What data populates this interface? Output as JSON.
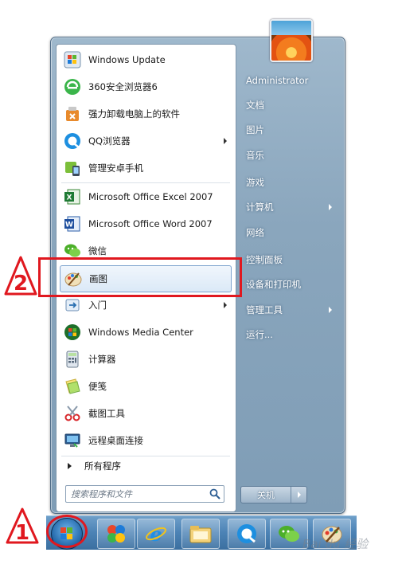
{
  "start_menu": {
    "programs": [
      {
        "label": "Windows Update",
        "icon": "windows-update-icon"
      },
      {
        "label": "360安全浏览器6",
        "icon": "360-browser-icon"
      },
      {
        "label": "强力卸载电脑上的软件",
        "icon": "uninstall-icon"
      },
      {
        "label": "QQ浏览器",
        "icon": "qq-browser-icon",
        "has_submenu": true
      },
      {
        "label": "管理安卓手机",
        "icon": "android-manager-icon"
      },
      {
        "label": "Microsoft Office Excel 2007",
        "icon": "excel-icon"
      },
      {
        "label": "Microsoft Office Word 2007",
        "icon": "word-icon"
      },
      {
        "label": "微信",
        "icon": "wechat-icon"
      },
      {
        "label": "画图",
        "icon": "paint-icon",
        "highlighted": true
      },
      {
        "label": "入门",
        "icon": "getting-started-icon",
        "has_submenu": true
      },
      {
        "label": "Windows Media Center",
        "icon": "media-center-icon"
      },
      {
        "label": "计算器",
        "icon": "calculator-icon"
      },
      {
        "label": "便笺",
        "icon": "sticky-notes-icon"
      },
      {
        "label": "截图工具",
        "icon": "snipping-tool-icon"
      },
      {
        "label": "远程桌面连接",
        "icon": "remote-desktop-icon"
      }
    ],
    "all_programs": "所有程序",
    "search_placeholder": "搜索程序和文件",
    "right_items": [
      {
        "label": "Administrator"
      },
      {
        "label": "文档"
      },
      {
        "label": "图片"
      },
      {
        "label": "音乐"
      },
      {
        "label": "游戏"
      },
      {
        "label": "计算机",
        "has_submenu": true
      },
      {
        "label": "网络"
      },
      {
        "label": "控制面板"
      },
      {
        "label": "设备和打印机"
      },
      {
        "label": "管理工具",
        "has_submenu": true
      },
      {
        "label": "运行..."
      }
    ],
    "shutdown_label": "关机"
  },
  "taskbar": {
    "items": [
      {
        "icon": "start-orb-icon"
      },
      {
        "icon": "360-browser-icon"
      },
      {
        "icon": "internet-explorer-icon"
      },
      {
        "icon": "file-explorer-icon"
      },
      {
        "icon": "qq-browser-icon"
      },
      {
        "icon": "wechat-icon"
      },
      {
        "icon": "paint-icon"
      }
    ]
  },
  "annotations": {
    "step1": "1",
    "step2": "2",
    "color": "#e0181f"
  },
  "watermark": "Bai du 经验"
}
